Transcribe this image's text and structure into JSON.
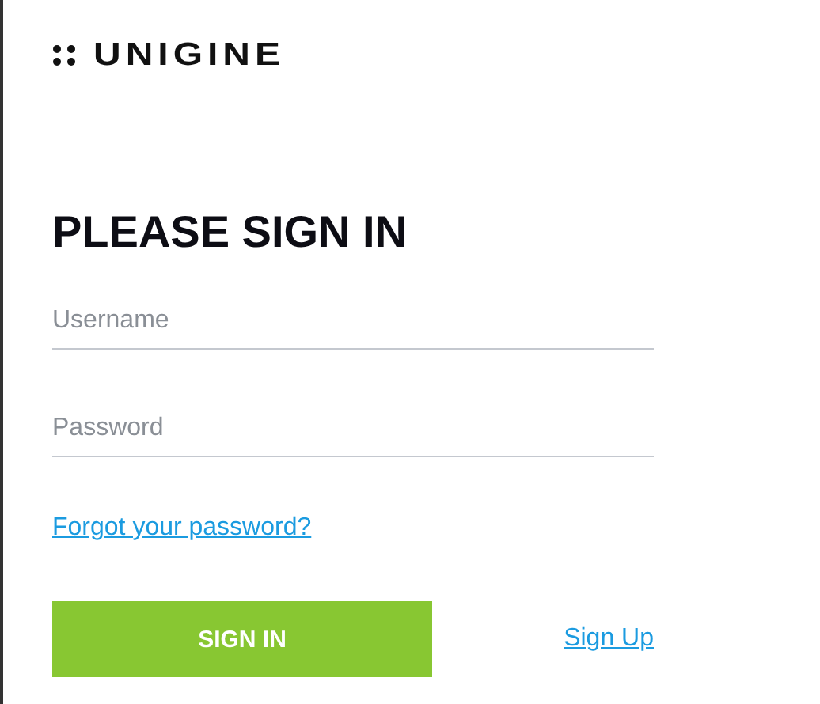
{
  "logo": {
    "wordmark": "UNIGINE"
  },
  "heading": "PLEASE SIGN IN",
  "fields": [
    {
      "placeholder": "Username"
    },
    {
      "placeholder": "Password"
    }
  ],
  "forgot_link": "Forgot your password?",
  "sign_in_button": "SIGN IN",
  "sign_up_link": "Sign Up"
}
